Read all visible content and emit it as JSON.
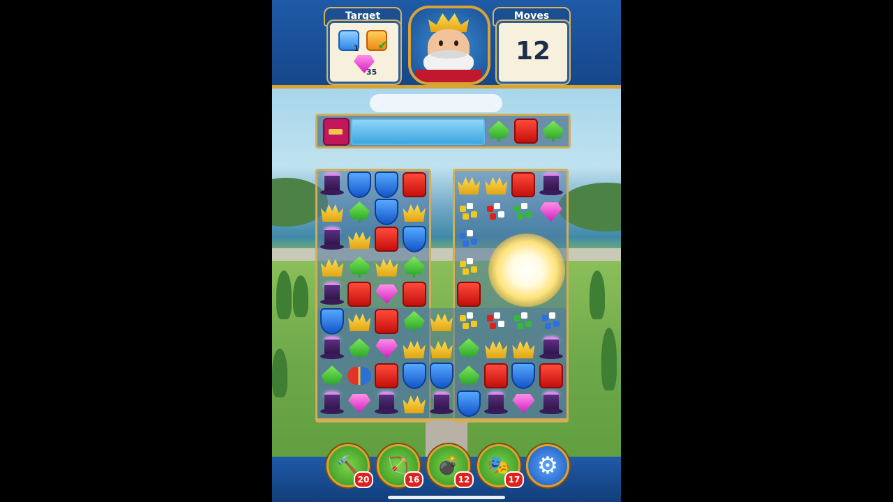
{
  "header": {
    "target_label": "Target",
    "moves_label": "Moves",
    "moves_value": "12",
    "targets": [
      {
        "item": "blue-cube",
        "count": "1"
      },
      {
        "item": "orange-cube",
        "status": "complete"
      },
      {
        "item": "pink-gem",
        "count": "35"
      }
    ]
  },
  "top_row": {
    "tiles": [
      "chest",
      "ice",
      "leaf",
      "cube",
      "leaf"
    ]
  },
  "board_left": {
    "rows": [
      [
        "hat",
        "shield",
        "shield",
        "cube"
      ],
      [
        "crown",
        "leaf",
        "shield",
        "crown"
      ],
      [
        "hat",
        "crown",
        "cube",
        "shield"
      ],
      [
        "crown",
        "leaf",
        "crown",
        "leaf"
      ],
      [
        "hat",
        "cube",
        "gem",
        "cube"
      ],
      [
        "shield",
        "crown",
        "cube",
        "leaf",
        "crown",
        "sparkle",
        "sparkle",
        "sparkle",
        "sparkle"
      ],
      [
        "hat",
        "leaf",
        "gem",
        "crown",
        "crown",
        "leaf",
        "crown",
        "crown",
        "hat"
      ],
      [
        "leaf",
        "rocket",
        "cube",
        "shield",
        "shield",
        "leaf",
        "cube",
        "shield",
        "cube"
      ],
      [
        "hat",
        "gem",
        "hat",
        "crown",
        "hat",
        "shield",
        "hat",
        "gem",
        "hat"
      ]
    ]
  },
  "board_right": {
    "rows": [
      [
        "crown",
        "crown",
        "cube",
        "hat"
      ],
      [
        "sparkle",
        "sparkle",
        "sparkle",
        "gem"
      ],
      [
        "sparkle",
        "",
        "",
        ""
      ],
      [
        "sparkle",
        "",
        "",
        ""
      ],
      [
        "cube",
        "",
        "",
        ""
      ]
    ]
  },
  "boosters": [
    {
      "name": "hammer",
      "glyph": "🔨",
      "count": "20"
    },
    {
      "name": "arrow",
      "glyph": "🏹",
      "count": "16"
    },
    {
      "name": "cannon",
      "glyph": "💣",
      "count": "12"
    },
    {
      "name": "jester-hat",
      "glyph": "🎭",
      "count": "17"
    }
  ],
  "settings_icon": "gear-icon",
  "colors": {
    "topbar": "#1f5aa8",
    "gold_border": "#d9a336",
    "badge_red": "#e0201b"
  }
}
